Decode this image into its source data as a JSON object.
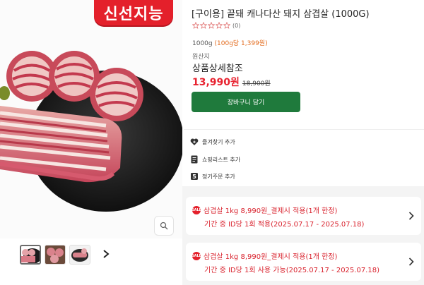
{
  "brand": {
    "badge_text": "신선지능",
    "badge_color": "#e4202b"
  },
  "gallery": {
    "zoom_icon": "magnifier-icon",
    "thumbnails": [
      {
        "name": "thumbnail-pork-belly-plate",
        "active": true
      },
      {
        "name": "thumbnail-pork-belly-rolls",
        "active": false
      },
      {
        "name": "thumbnail-pork-belly-slices",
        "active": false
      }
    ],
    "next_icon": "chevron-right-icon"
  },
  "product": {
    "title": "[구이용] 끝돼 캐나다산 돼지 삼겹살 (1000G)",
    "rating_stars": 0,
    "review_count": "(0)",
    "weight": "1000g",
    "unit_price": "(100g당 1,399원)",
    "origin_label": "원산지",
    "origin_value": "상품상세참조",
    "sale_price": "13,990원",
    "original_price": "18,900원",
    "cart_button": "장바구니 담기",
    "cart_button_color": "#1f7a3c"
  },
  "actions": [
    {
      "icon": "heart-plus-icon",
      "label": "즐겨찾기 추가"
    },
    {
      "icon": "list-icon",
      "label": "쇼핑리스트 추가"
    },
    {
      "icon": "subscription-icon",
      "label": "정기주문 추가"
    }
  ],
  "coupons": [
    {
      "badge": "SALE",
      "headline": "삼겹살 1kg 8,990원_결제시 적용(1개 한정)",
      "detail": "기간 중 ID당 1회 적용(2025.07.17 - 2025.07.18)"
    },
    {
      "badge": "SALE",
      "headline": "삼겹살 1kg 8,990원_결제시 적용(1개 한정)",
      "detail": "기간 중 ID당 1회 사용 가능(2025.07.17 - 2025.07.18)"
    }
  ]
}
